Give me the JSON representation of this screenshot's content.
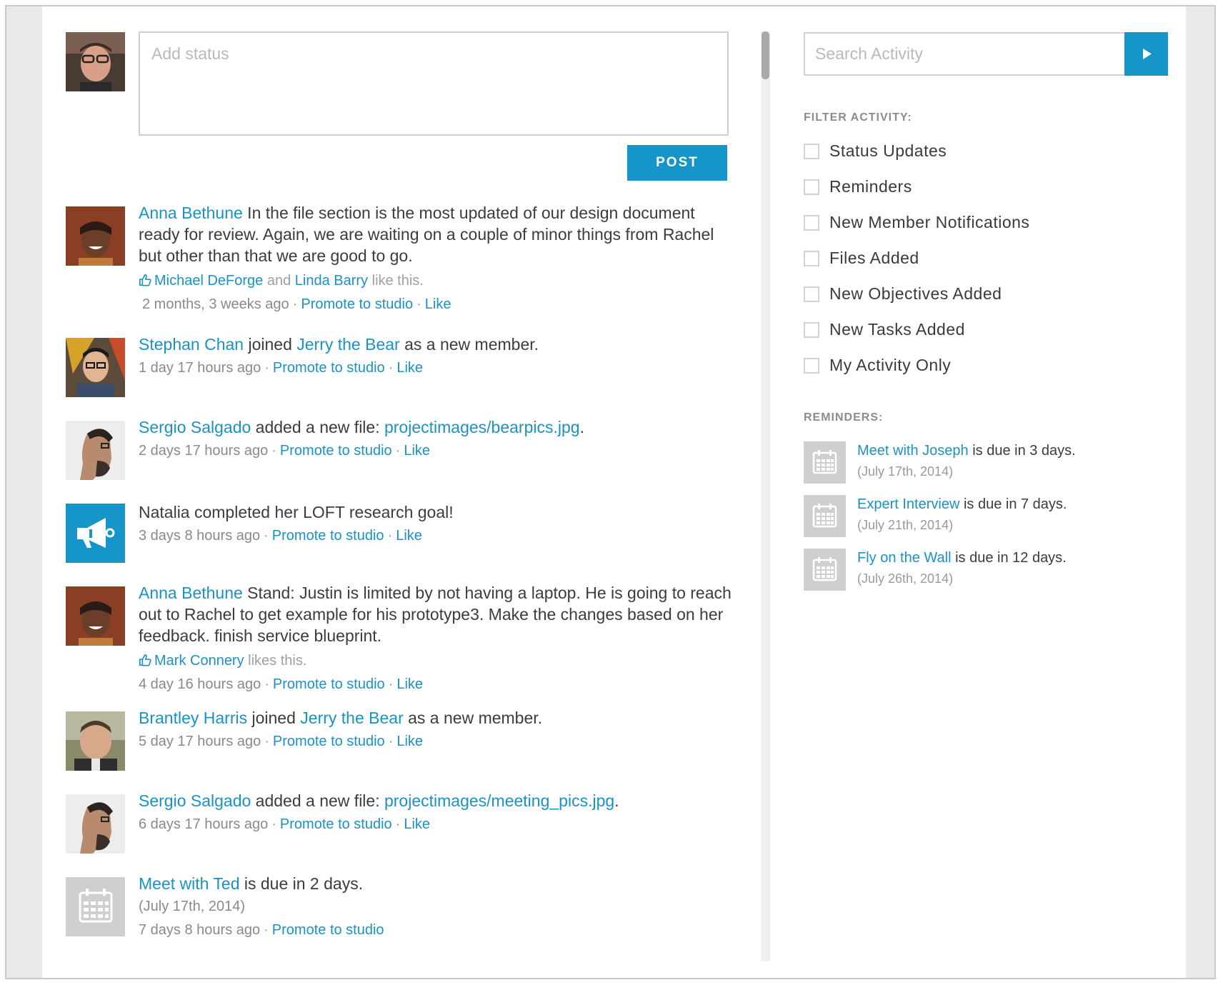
{
  "composer": {
    "placeholder": "Add status",
    "post_label": "POST"
  },
  "feed": [
    {
      "name": "Anna Bethune",
      "text": " In the file section is the most updated of our design document ready for review. Again, we are waiting on a couple of minor things from Rachel but other than that we are good to go.",
      "likes": {
        "people": [
          "Michael DeForge",
          "Linda Barry"
        ],
        "and": " and ",
        "suffix": " like this."
      },
      "time": "2 months, 3 weeks ago",
      "promote": "Promote to studio",
      "like": "Like"
    },
    {
      "name": "Stephan Chan",
      "mid": " joined ",
      "target": "Jerry the Bear",
      "end": " as a new member.",
      "time": "1 day 17 hours ago",
      "promote": "Promote to studio",
      "like": "Like"
    },
    {
      "name": "Sergio Salgado",
      "mid": " added a new file: ",
      "target": "projectimages/bearpics.jpg",
      "end": ".",
      "time": "2 days 17 hours ago",
      "promote": "Promote to studio",
      "like": "Like"
    },
    {
      "text": "Natalia completed her LOFT research goal!",
      "time": "3 days 8 hours ago",
      "promote": "Promote to studio",
      "like": "Like"
    },
    {
      "name": "Anna Bethune",
      "text": " Stand: Justin is limited by not having a laptop. He is going to reach out to Rachel to get example for his prototype3. Make the changes based on her feedback. finish service blueprint.",
      "likes": {
        "people": [
          "Mark Connery"
        ],
        "suffix": " likes this."
      },
      "time": "4 day 16 hours ago",
      "promote": "Promote to studio",
      "like": "Like"
    },
    {
      "name": "Brantley Harris",
      "mid": " joined ",
      "target": "Jerry the Bear",
      "end": " as a new member.",
      "time": "5 day 17 hours ago",
      "promote": "Promote to studio",
      "like": "Like"
    },
    {
      "name": "Sergio Salgado",
      "mid": " added a new file: ",
      "target": "projectimages/meeting_pics.jpg",
      "end": ".",
      "time": "6 days 17 hours ago",
      "promote": "Promote to studio",
      "like": "Like"
    },
    {
      "name": "Meet with Ted",
      "end": " is due in 2 days.",
      "date": "(July 17th, 2014)",
      "time": "7 days 8 hours ago",
      "promote": "Promote to studio"
    }
  ],
  "search": {
    "placeholder": "Search Activity",
    "icon": "play-arrow-icon"
  },
  "filter": {
    "heading": "FILTER ACTIVITY:",
    "options": [
      "Status Updates",
      "Reminders",
      "New Member Notifications",
      "Files Added",
      "New Objectives Added",
      "New Tasks Added",
      "My Activity Only"
    ]
  },
  "reminders": {
    "heading": "REMINDERS:",
    "items": [
      {
        "title": "Meet with Joseph",
        "suffix": " is due in 3 days.",
        "date": "(July 17th, 2014)"
      },
      {
        "title": "Expert Interview",
        "suffix": " is due in 7 days.",
        "date": "(July 21th, 2014)"
      },
      {
        "title": "Fly on the Wall",
        "suffix": " is due in 12 days.",
        "date": "(July 26th, 2014)"
      }
    ]
  },
  "colors": {
    "accent": "#1696c8",
    "link": "#1a92c4",
    "frame": "#e9e9e9"
  }
}
